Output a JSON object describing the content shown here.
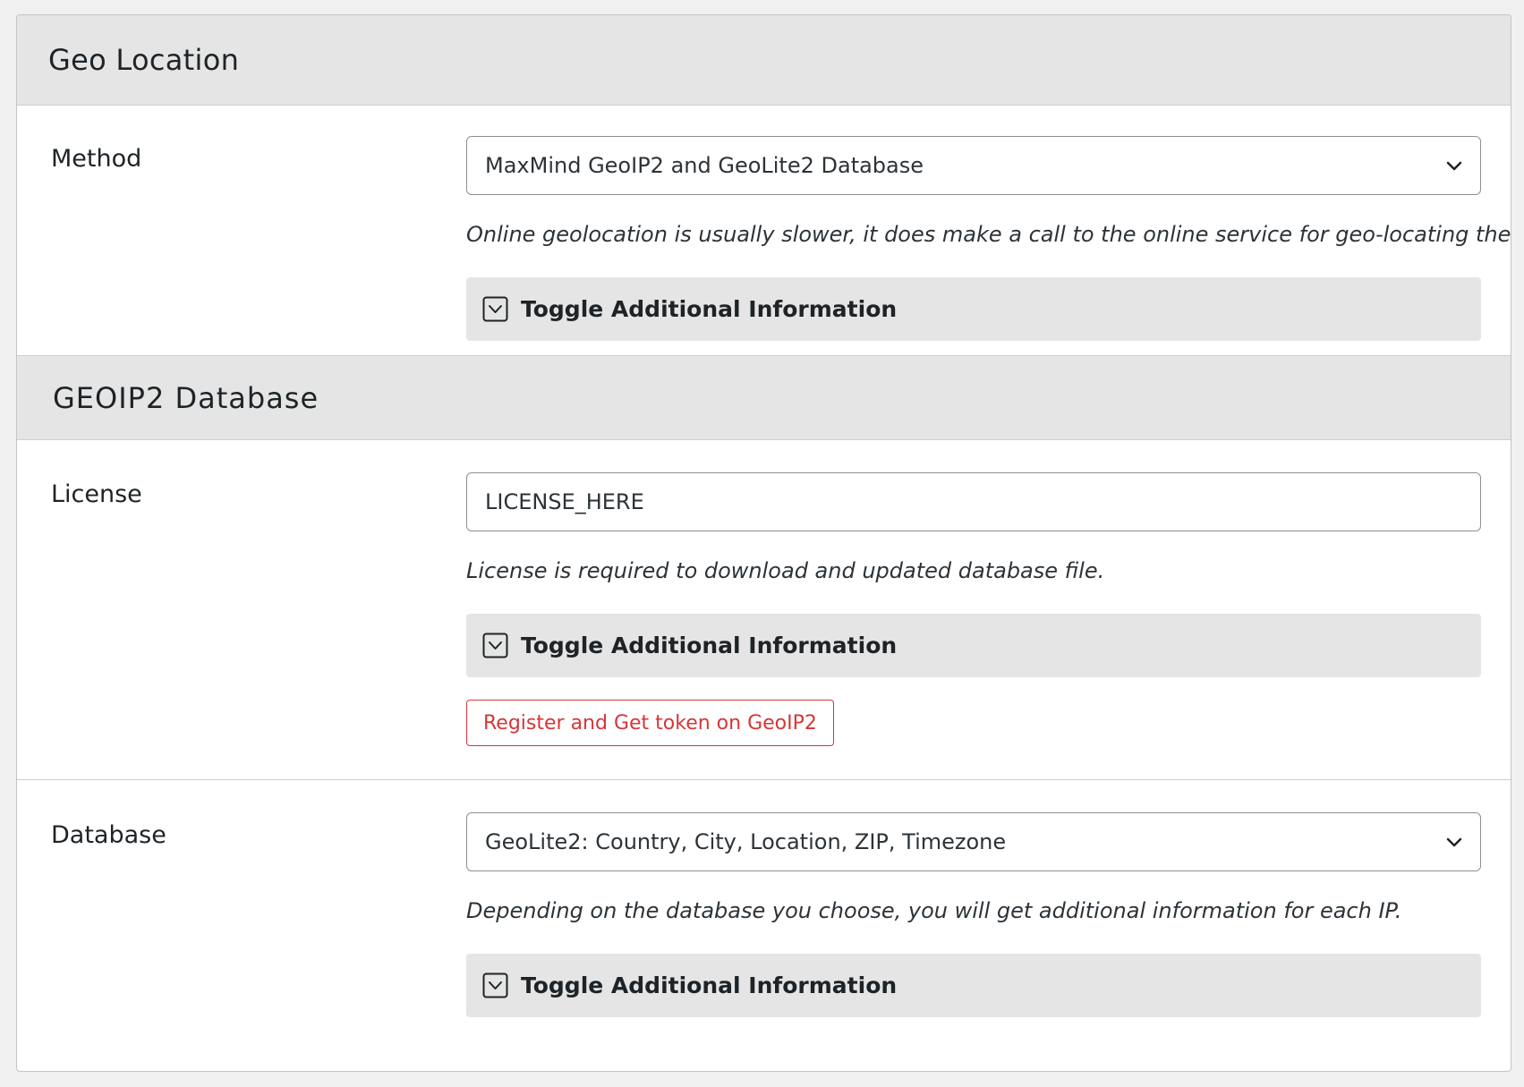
{
  "geo_location": {
    "title": "Geo Location",
    "method": {
      "label": "Method",
      "selected": "MaxMind GeoIP2 and GeoLite2 Database",
      "description": "Online geolocation is usually slower, it does make a call to the online service for geo-locating the IP.",
      "toggle_label": "Toggle Additional Information"
    }
  },
  "geoip2_database": {
    "title": "GEOIP2 Database",
    "license": {
      "label": "License",
      "value": "LICENSE_HERE",
      "description": "License is required to download and updated database file.",
      "toggle_label": "Toggle Additional Information",
      "register_button": "Register and Get token on GeoIP2"
    },
    "database": {
      "label": "Database",
      "selected": "GeoLite2: Country, City, Location, ZIP, Timezone",
      "description": "Depending on the database you choose, you will get additional information for each IP.",
      "toggle_label": "Toggle Additional Information"
    }
  },
  "icons": {
    "select_arrow": "chevron-down-icon",
    "toggle": "toggle-chevron-icon"
  },
  "colors": {
    "accent_red": "#d63638",
    "header_bg": "#e5e5e5",
    "page_bg": "#f0f0f1"
  }
}
